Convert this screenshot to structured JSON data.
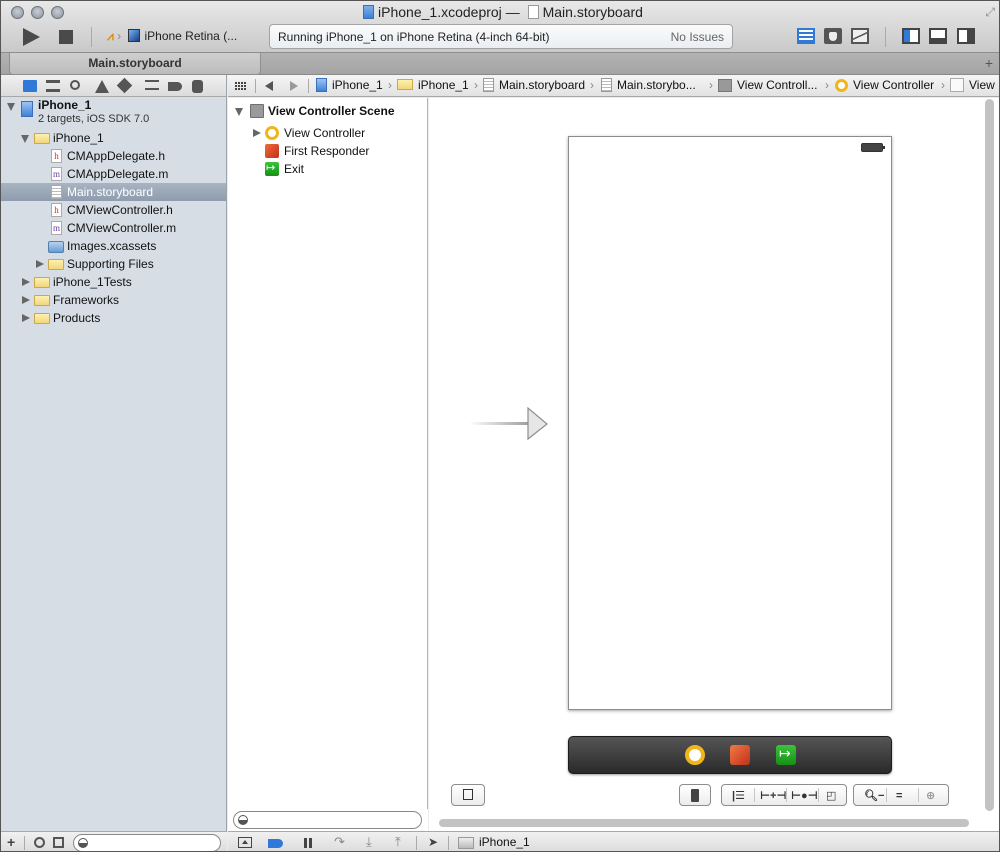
{
  "window": {
    "project_file": "iPhone_1.xcodeproj",
    "separator": "—",
    "document": "Main.storyboard"
  },
  "toolbar": {
    "run_label": "Run",
    "stop_label": "Stop",
    "scheme_target": "iPhone Retina (...",
    "activity_status": "Running iPhone_1 on iPhone Retina (4-inch 64-bit)",
    "issues": "No Issues",
    "editor_modes": [
      "standard-editor",
      "assistant-editor",
      "version-editor"
    ],
    "active_editor_mode": "standard-editor",
    "panels": [
      "navigator",
      "debug-area",
      "utilities"
    ],
    "active_panels": [
      "navigator"
    ]
  },
  "tabs": [
    {
      "label": "Main.storyboard",
      "active": true
    }
  ],
  "navigator": {
    "selector_icons": [
      "project-navigator",
      "symbol-navigator",
      "find-navigator",
      "issue-navigator",
      "test-navigator",
      "debug-navigator",
      "breakpoint-navigator",
      "log-navigator"
    ],
    "active_selector": "project-navigator",
    "project": {
      "name": "iPhone_1",
      "subtitle": "2 targets, iOS SDK 7.0"
    },
    "items": [
      {
        "label": "iPhone_1",
        "type": "folder",
        "level": 1,
        "expanded": true
      },
      {
        "label": "CMAppDelegate.h",
        "type": "h-file",
        "level": 2
      },
      {
        "label": "CMAppDelegate.m",
        "type": "m-file",
        "level": 2
      },
      {
        "label": "Main.storyboard",
        "type": "storyboard",
        "level": 2,
        "selected": true
      },
      {
        "label": "CMViewController.h",
        "type": "h-file",
        "level": 2
      },
      {
        "label": "CMViewController.m",
        "type": "m-file",
        "level": 2
      },
      {
        "label": "Images.xcassets",
        "type": "assets",
        "level": 2
      },
      {
        "label": "Supporting Files",
        "type": "folder",
        "level": 2,
        "expanded": false
      },
      {
        "label": "iPhone_1Tests",
        "type": "folder",
        "level": 1,
        "expanded": false
      },
      {
        "label": "Frameworks",
        "type": "folder",
        "level": 1,
        "expanded": false
      },
      {
        "label": "Products",
        "type": "folder",
        "level": 1,
        "expanded": false
      }
    ],
    "filter_placeholder": ""
  },
  "jumpbar": {
    "crumbs": [
      {
        "label": "iPhone_1",
        "icon": "project"
      },
      {
        "label": "iPhone_1",
        "icon": "folder"
      },
      {
        "label": "Main.storyboard",
        "icon": "storyboard"
      },
      {
        "label": "Main.storybo...",
        "icon": "storyboard"
      },
      {
        "label": "View Controll...",
        "icon": "scene"
      },
      {
        "label": "View Controller",
        "icon": "view-controller"
      },
      {
        "label": "View",
        "icon": "view"
      }
    ]
  },
  "outline": {
    "scene": "View Controller Scene",
    "items": [
      {
        "label": "View Controller",
        "icon": "view-controller",
        "expandable": true
      },
      {
        "label": "First Responder",
        "icon": "first-responder"
      },
      {
        "label": "Exit",
        "icon": "exit"
      }
    ],
    "filter_placeholder": ""
  },
  "canvas": {
    "dock_items": [
      "view-controller",
      "first-responder",
      "exit"
    ],
    "zoom_controls": [
      "zoom-out",
      "zoom-actual",
      "zoom-in"
    ],
    "layout_controls": [
      "simulated-metrics",
      "align",
      "pin",
      "resolve-autolayout",
      "resizing"
    ]
  },
  "debugbar": {
    "device": "iPhone_1"
  }
}
